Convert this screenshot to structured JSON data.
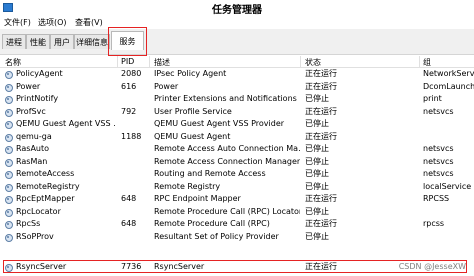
{
  "window": {
    "title": "任务管理器"
  },
  "menu": [
    {
      "label": "文件(F)"
    },
    {
      "label": "选项(O)"
    },
    {
      "label": "查看(V)"
    }
  ],
  "tabs": [
    {
      "label": "进程"
    },
    {
      "label": "性能"
    },
    {
      "label": "用户"
    },
    {
      "label": "详细信息"
    },
    {
      "label": "服务",
      "active": true
    }
  ],
  "columns": {
    "name": "名称",
    "pid": "PID",
    "description": "描述",
    "status": "状态",
    "group": "组"
  },
  "rows": [
    {
      "name": "PolicyAgent",
      "pid": "2080",
      "description": "IPsec Policy Agent",
      "status": "正在运行",
      "group": "NetworkServi"
    },
    {
      "name": "Power",
      "pid": "616",
      "description": "Power",
      "status": "正在运行",
      "group": "DcomLaunch"
    },
    {
      "name": "PrintNotify",
      "pid": "",
      "description": "Printer Extensions and Notifications",
      "status": "已停止",
      "group": "print"
    },
    {
      "name": "ProfSvc",
      "pid": "792",
      "description": "User Profile Service",
      "status": "正在运行",
      "group": "netsvcs"
    },
    {
      "name": "QEMU Guest Agent VSS ...",
      "pid": "",
      "description": "QEMU Guest Agent VSS Provider",
      "status": "已停止",
      "group": ""
    },
    {
      "name": "qemu-ga",
      "pid": "1188",
      "description": "QEMU Guest Agent",
      "status": "正在运行",
      "group": ""
    },
    {
      "name": "RasAuto",
      "pid": "",
      "description": "Remote Access Auto Connection Ma...",
      "status": "已停止",
      "group": "netsvcs"
    },
    {
      "name": "RasMan",
      "pid": "",
      "description": "Remote Access Connection Manager",
      "status": "已停止",
      "group": "netsvcs"
    },
    {
      "name": "RemoteAccess",
      "pid": "",
      "description": "Routing and Remote Access",
      "status": "已停止",
      "group": "netsvcs"
    },
    {
      "name": "RemoteRegistry",
      "pid": "",
      "description": "Remote Registry",
      "status": "已停止",
      "group": "localService"
    },
    {
      "name": "RpcEptMapper",
      "pid": "648",
      "description": "RPC Endpoint Mapper",
      "status": "正在运行",
      "group": "RPCSS"
    },
    {
      "name": "RpcLocator",
      "pid": "",
      "description": "Remote Procedure Call (RPC) Locator",
      "status": "已停止",
      "group": ""
    },
    {
      "name": "RpcSs",
      "pid": "648",
      "description": "Remote Procedure Call (RPC)",
      "status": "正在运行",
      "group": "rpcss"
    },
    {
      "name": "RSoPProv",
      "pid": "",
      "description": "Resultant Set of Policy Provider",
      "status": "已停止",
      "group": ""
    },
    {
      "name": "RsyncServer",
      "pid": "7736",
      "description": "RsyncServer",
      "status": "正在运行",
      "group": ""
    }
  ],
  "watermark": "CSDN @JesseXW",
  "colors": {
    "highlight": "#e52323"
  }
}
